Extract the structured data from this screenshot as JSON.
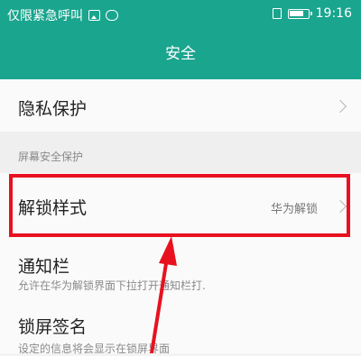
{
  "status_bar": {
    "carrier": "仅限紧急呼叫",
    "time": "19:16"
  },
  "header": {
    "title": "安全"
  },
  "items": {
    "privacy": {
      "label": "隐私保护"
    },
    "section_label": "屏幕安全保护",
    "unlock": {
      "label": "解锁样式",
      "value": "华为解锁"
    },
    "notification": {
      "label": "通知栏",
      "subtitle": "允许在华为解锁界面下拉打开通知栏打."
    },
    "lockscreen_signature": {
      "label": "锁屏签名",
      "subtitle": "设定的信息将会显示在锁屏界面"
    }
  },
  "colors": {
    "header": "#1aa58e",
    "highlight": "#e8111f"
  }
}
